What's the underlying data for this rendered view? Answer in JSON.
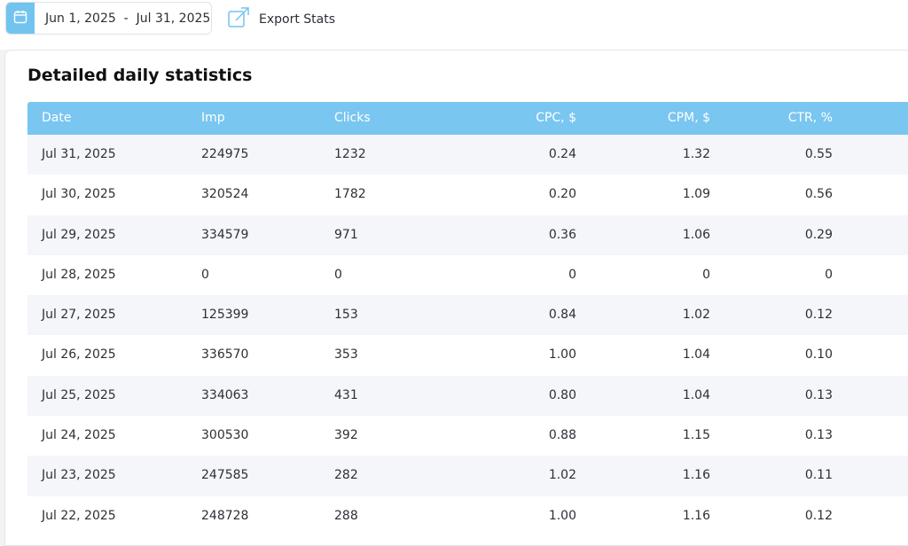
{
  "toolbar": {
    "date_range": "Jun 1, 2025  -  Jul 31, 2025",
    "export_label": "Export Stats",
    "calendar_icon": "calendar-icon",
    "export_icon": "external-link-icon",
    "accent_color": "#72c4ef"
  },
  "stats": {
    "title": "Detailed daily statistics",
    "columns": [
      "Date",
      "Imp",
      "Clicks",
      "CPC, $",
      "CPM, $",
      "CTR, %"
    ],
    "header_color": "#79c6f0",
    "rows": [
      [
        "Jul 31, 2025",
        "224975",
        "1232",
        "0.24",
        "1.32",
        "0.55"
      ],
      [
        "Jul 30, 2025",
        "320524",
        "1782",
        "0.20",
        "1.09",
        "0.56"
      ],
      [
        "Jul 29, 2025",
        "334579",
        "971",
        "0.36",
        "1.06",
        "0.29"
      ],
      [
        "Jul 28, 2025",
        "0",
        "0",
        "0",
        "0",
        "0"
      ],
      [
        "Jul 27, 2025",
        "125399",
        "153",
        "0.84",
        "1.02",
        "0.12"
      ],
      [
        "Jul 26, 2025",
        "336570",
        "353",
        "1.00",
        "1.04",
        "0.10"
      ],
      [
        "Jul 25, 2025",
        "334063",
        "431",
        "0.80",
        "1.04",
        "0.13"
      ],
      [
        "Jul 24, 2025",
        "300530",
        "392",
        "0.88",
        "1.15",
        "0.13"
      ],
      [
        "Jul 23, 2025",
        "247585",
        "282",
        "1.02",
        "1.16",
        "0.11"
      ],
      [
        "Jul 22, 2025",
        "248728",
        "288",
        "1.00",
        "1.16",
        "0.12"
      ]
    ]
  }
}
